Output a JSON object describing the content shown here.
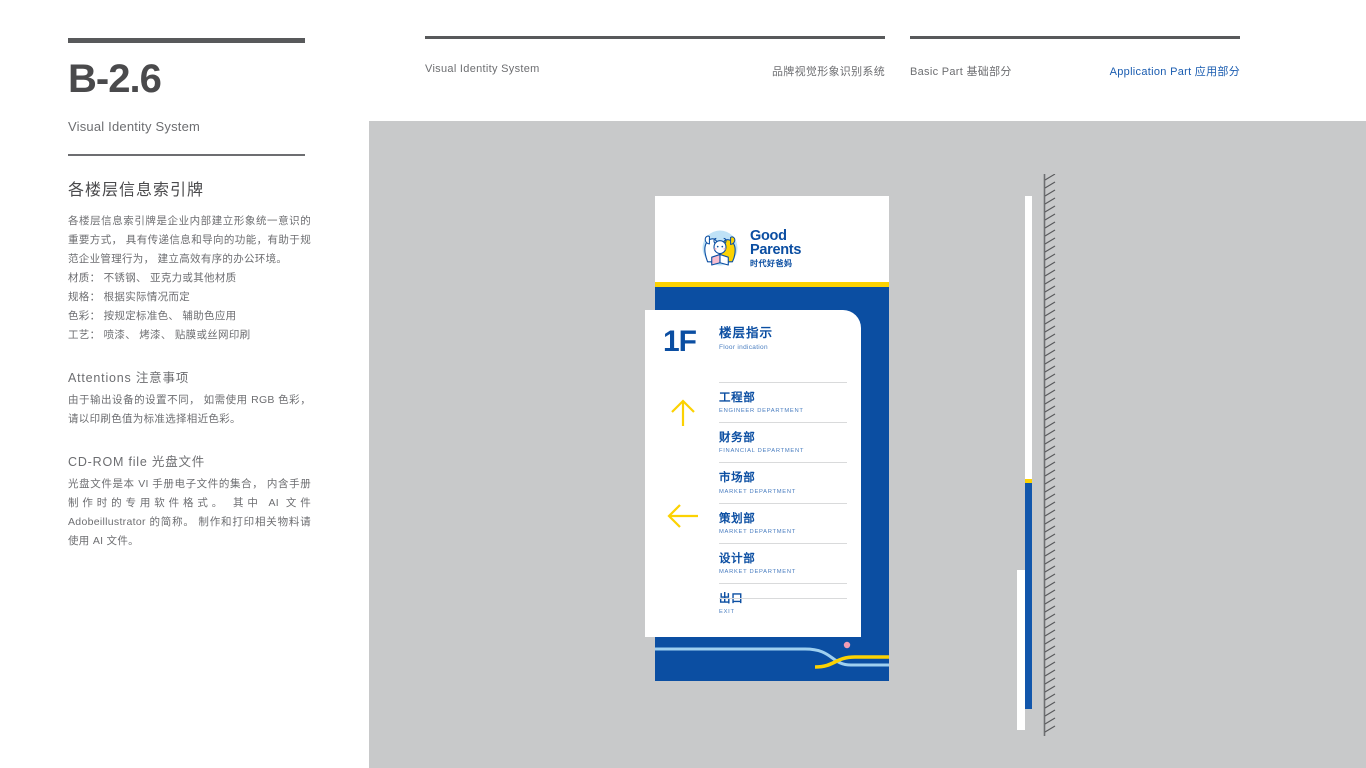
{
  "left": {
    "page_code": "B-2.6",
    "subtitle": "Visual Identity System",
    "section_title": "各楼层信息索引牌",
    "intro": "各楼层信息索引牌是企业内部建立形象统一意识的重要方式， 具有传递信息和导向的功能，有助于规范企业管理行为， 建立高效有序的办公环境。",
    "specs": [
      "材质： 不锈钢、 亚克力或其他材质",
      "规格： 根据实际情况而定",
      "色彩： 按规定标准色、 辅助色应用",
      "工艺： 喷漆、 烤漆、 贴膜或丝网印刷"
    ],
    "attentions_heading": "Attentions 注意事项",
    "attentions_body": "由于输出设备的设置不同， 如需使用 RGB 色彩， 请以印刷色值为标准选择相近色彩。",
    "cdrom_heading": "CD-ROM file 光盘文件",
    "cdrom_body": "光盘文件是本 VI 手册电子文件的集合， 内含手册制作时的专用软件格式。 其中 AI 文件 Adobeillustrator 的简称。 制作和打印相关物料请使用 AI 文件。"
  },
  "nav": {
    "item1": "Visual Identity System",
    "item2": "品牌视觉形象识别系统",
    "item3": "Basic Part 基础部分",
    "item4": "Application Part 应用部分",
    "active_color": "#1a5cb0"
  },
  "sign": {
    "logo": {
      "word1": "Good",
      "word2": "Parents",
      "chinese": "时代好爸妈",
      "mark_name": "family-reading-mascot"
    },
    "floor": {
      "number": "1F",
      "label_cn": "楼层指示",
      "label_en": "Floor indication"
    },
    "rows": [
      {
        "cn": "工程部",
        "en": "ENGINEER DEPARTMENT"
      },
      {
        "cn": "财务部",
        "en": "FINANCIAL DEPARTMENT"
      },
      {
        "cn": "市场部",
        "en": "MARKET DEPARTMENT"
      },
      {
        "cn": "策划部",
        "en": "MARKET DEPARTMENT"
      },
      {
        "cn": "设计部",
        "en": "MARKET DEPARTMENT"
      },
      {
        "cn": "出口",
        "en": "EXIT"
      }
    ],
    "arrows": [
      {
        "name": "arrow-up-icon",
        "direction": "up"
      },
      {
        "name": "arrow-left-icon",
        "direction": "left"
      }
    ]
  },
  "colors": {
    "brand_blue": "#0b4ea2",
    "brand_yellow": "#fcd202",
    "canvas_grey": "#c8c9ca",
    "accent_pink": "#f29cb4",
    "light_blue": "#9fd0f0"
  }
}
